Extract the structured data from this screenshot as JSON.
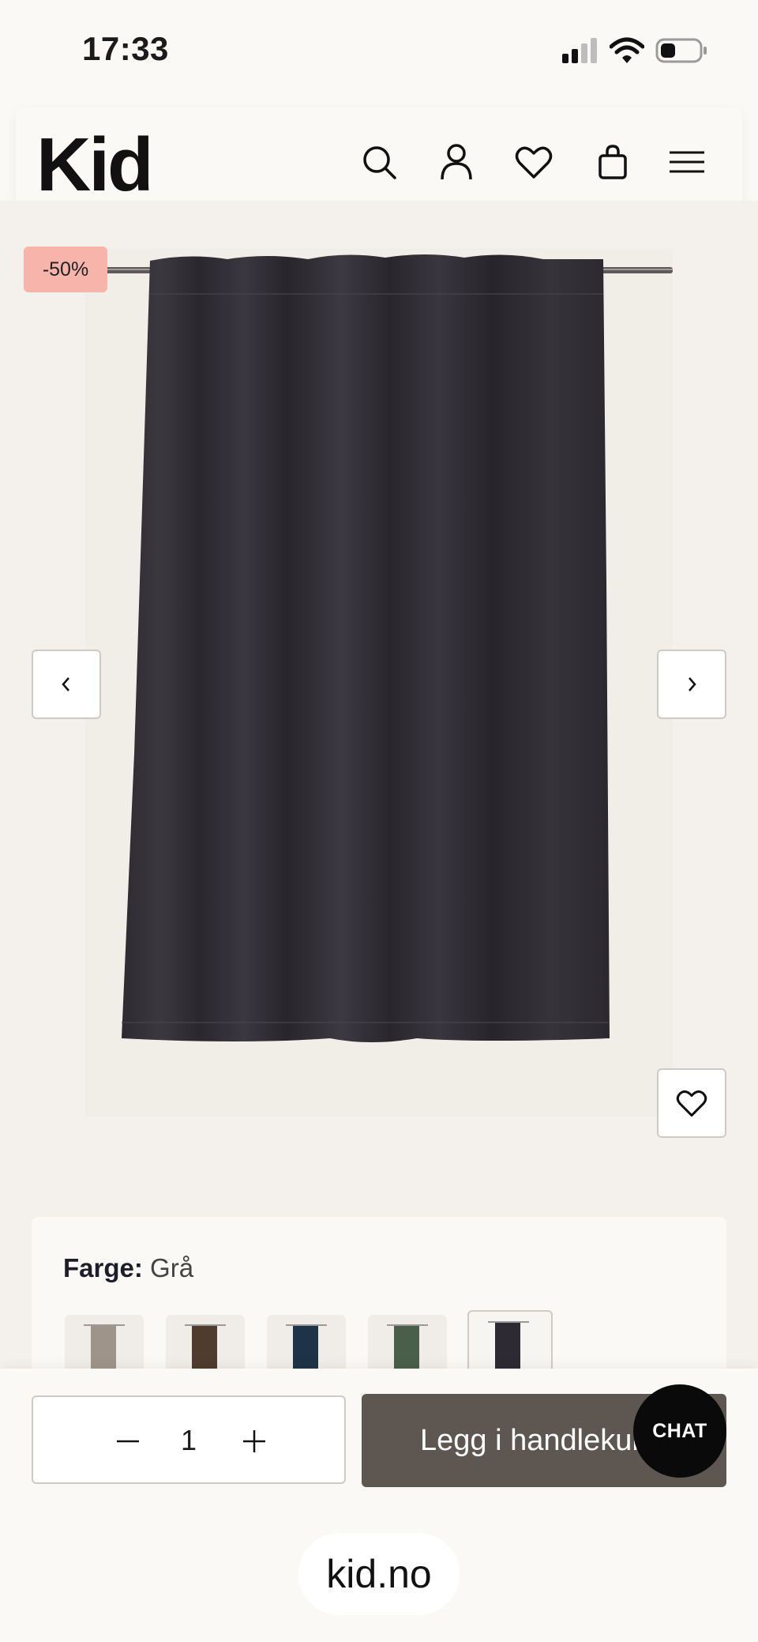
{
  "status_bar": {
    "time": "17:33"
  },
  "header": {
    "logo": "Kid",
    "icons": [
      "search-icon",
      "account-icon",
      "wishlist-icon",
      "cart-icon",
      "menu-icon"
    ]
  },
  "product": {
    "discount_badge": "-50%",
    "image_color": "#3a363d"
  },
  "color_selector": {
    "label": "Farge:",
    "selected": "Grå",
    "swatches": [
      {
        "name": "beige",
        "color": "#9f948a"
      },
      {
        "name": "brown",
        "color": "#4f3c2d"
      },
      {
        "name": "navy",
        "color": "#1e3347"
      },
      {
        "name": "green",
        "color": "#4a5f4a"
      },
      {
        "name": "grey",
        "color": "#2e2a33"
      }
    ]
  },
  "purchase": {
    "quantity": "1",
    "add_to_cart_label": "Legg i handlekurv",
    "chat_label": "CHAT"
  },
  "browser": {
    "url": "kid.no"
  }
}
